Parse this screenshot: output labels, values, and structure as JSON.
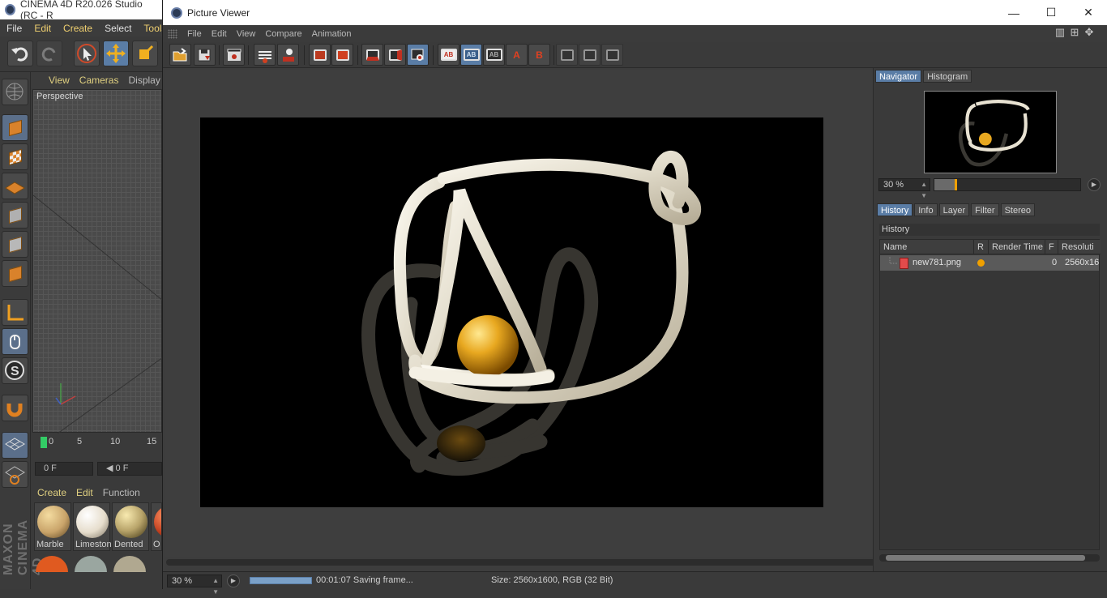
{
  "main_window": {
    "title": "CINEMA 4D R20.026 Studio (RC - R",
    "menu": [
      "File",
      "Edit",
      "Create",
      "Select",
      "Tools"
    ],
    "viewport_menu": [
      "View",
      "Cameras",
      "Display"
    ],
    "viewport_label": "Perspective",
    "timeline_ticks": [
      "0",
      "5",
      "10",
      "15"
    ],
    "frame_start": "0 F",
    "frame_field": "◀ 0 F",
    "material_menu": [
      "Create",
      "Edit",
      "Function"
    ],
    "materials": [
      {
        "name": "Marble",
        "color": "#c9a46a"
      },
      {
        "name": "Limestone",
        "color": "#e6ddcc"
      },
      {
        "name": "Dented",
        "color": "#b8a46a"
      },
      {
        "name": "O",
        "color": "#c04020"
      }
    ],
    "brand": "MAXON CINEMA 4D"
  },
  "picture_viewer": {
    "title": "Picture Viewer",
    "window_controls": {
      "minimize": "—",
      "maximize": "☐",
      "close": "✕"
    },
    "menu": [
      "File",
      "Edit",
      "View",
      "Compare",
      "Animation"
    ],
    "toolbar_labels": {
      "ab": "AB",
      "a": "A",
      "b": "B"
    },
    "status": {
      "zoom": "30 %",
      "progress": 1.0,
      "message": "00:01:07 Saving frame...",
      "size": "Size: 2560x1600, RGB (32 Bit)"
    },
    "right_panel": {
      "top_tabs": [
        "Navigator",
        "Histogram"
      ],
      "active_top_tab": "Navigator",
      "nav_zoom": "30 %",
      "nav_zoom_fraction": 0.14,
      "bottom_tabs": [
        "History",
        "Info",
        "Layer",
        "Filter",
        "Stereo"
      ],
      "active_bottom_tab": "History",
      "history_title": "History",
      "columns": [
        "Name",
        "R",
        "Render Time",
        "F",
        "Resoluti"
      ],
      "rows": [
        {
          "name": "new781.png",
          "render_time": "",
          "frame": "0",
          "resolution": "2560x16",
          "status_color": "#f0a000"
        }
      ]
    }
  },
  "colors": {
    "accent": "#5a7da6",
    "status_dot": "#f0a000",
    "sphere": "#e8a820",
    "tube": "#e8e2d2"
  }
}
